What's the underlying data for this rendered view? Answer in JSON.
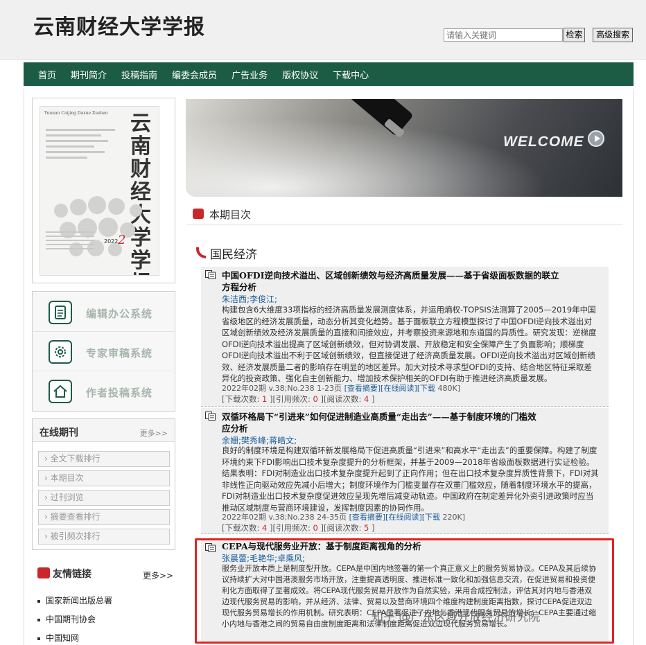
{
  "header": {
    "site_title": "云南财经大学学报",
    "search_placeholder": "请输入关键词",
    "search_button": "检索",
    "advanced_button": "高级搜索"
  },
  "nav": {
    "items": [
      "首页",
      "期刊简介",
      "投稿指南",
      "编委会成员",
      "广告业务",
      "版权协议",
      "下载中心"
    ]
  },
  "cover": {
    "header_text": "Yunnan Caijing Daxue Xuebao",
    "title_calligraphy": "云南财经大学学报",
    "year": "2022",
    "issue": "2"
  },
  "systems": {
    "items": [
      "编辑办公系统",
      "专家审稿系统",
      "作者投稿系统"
    ]
  },
  "online": {
    "title": "在线期刊",
    "more": "更多>>",
    "items": [
      "全文下载排行",
      "本期目次",
      "过刊浏览",
      "摘要查看排行",
      "被引频次排行"
    ]
  },
  "links": {
    "title": "友情链接",
    "more": "更多>>",
    "items": [
      "国家新闻出版总署",
      "中国期刊协会",
      "中国知网"
    ]
  },
  "banner": {
    "welcome": "WELCOME"
  },
  "contents": {
    "title": "本期目次",
    "category": "国民经济"
  },
  "articles": [
    {
      "title_line1": "中国OFDI逆向技术溢出、区域创新绩效与经济高质量发展——基于省级面板数据的联立",
      "title_line2": "方程分析",
      "authors": "朱洁西;李俊江;",
      "abstract": "构建包含6大维度33项指标的经济高质量发展测度体系，并运用熵权-TOPSIS法测算了2005—2019年中国省级地区的经济发展质量，动态分析其变化趋势。基于面板联立方程模型探讨了中国OFDI逆向技术溢出对区域创新绩效及经济发展质量的直接和间接效应，并考察投资来源地和东道国的异质性。研究发现：逆梯度OFDI逆向技术溢出提高了区域创新绩效，但对协调发展、开放稳定和安全保障产生了负面影响；顺梯度OFDI逆向技术溢出不利于区域创新绩效，但直接促进了经济高质量发展。OFDI逆向技术溢出对区域创新绩效、经济发展质量二者的影响存在明显的地区差异。加大对技术寻求型OFDI的支持、结合地区特征采取差异化的投资政策、强化自主创新能力、增加技术保护相关的OFDI有助于推进经济高质量发展。",
      "meta_prefix": "2022年02期 v.38;No.238 1-23页",
      "link_abstract": "[查看摘要]",
      "link_online": "[在线阅读]",
      "link_download": "[下载",
      "size": "480K]",
      "downloads": "1",
      "citations": "0",
      "reads": "4"
    },
    {
      "title_line1": "双循环格局下“引进来”如何促进制造业高质量“走出去”——基于制度环境的门槛效",
      "title_line2": "应分析",
      "authors": "余姗;樊秀峰;蒋皓文;",
      "abstract": "良好的制度环境是构建双循环新发展格局下促进高质量“引进来”和高水平“走出去”的重要保障。构建了制度环境约束下FDI影响出口技术复杂度提升的分析框架，并基于2009—2018年省级面板数据进行实证检验。结果表明：FDI对制造业出口技术复杂度提升起到了正向作用；但在出口技术复杂度异质性背景下，FDI对其非线性正向驱动效应先减小后增大；制度环境作为门槛变量存在双重门槛效应，随着制度环境水平的提高，FDI对制造业出口技术复杂度促进效应呈现先增后减变动轨迹。中国政府在制定差异化外资引进政策时应当推动区域制度与营商环境建设，发挥制度因素的协同作用。",
      "meta_prefix": "2022年02期 v.38;No.238 24-35页",
      "link_abstract": "[查看摘要]",
      "link_online": "[在线阅读]",
      "link_download": "[下载",
      "size": "220K]",
      "downloads": "4",
      "citations": "0",
      "reads": "5"
    },
    {
      "title_line1": "CEPA与现代服务业开放：基于制度距离视角的分析",
      "authors": "张晨蕾;毛艳华;卓乘风;",
      "abstract": "服务业开放本质上是制度型开放。CEPA是中国内地签署的第一个真正意义上的服务贸易协议。CEPA及其后续协议持续扩大对中国港澳服务市场开放，注重提高透明度、推进标准一致化和加强信息交流，在促进贸易和投资便利化方面取得了显著成效。将CEPA现代服务贸易开放作为自然实验，采用合成控制法，评估其对内地与香港双边现代服务贸易的影响，并从经济、法律、贸易以及营商环境四个维度构建制度距离指数，探讨CEPA促进双边现代服务贸易增长的作用机制。研究表明：CEPA显著促进了内地与香港现代服务贸易的增长；CEPA主要通过缩小内地与香港之间的贸易自由度制度距离和法律制度距离促进双边现代服务贸易增长。"
    }
  ],
  "stats_labels": {
    "downloads": "[下载次数:",
    "citations": "][引用频次:",
    "reads": "][阅读次数:",
    "end": "]"
  },
  "watermark": "知乎 @广东区域开放经济研究院"
}
